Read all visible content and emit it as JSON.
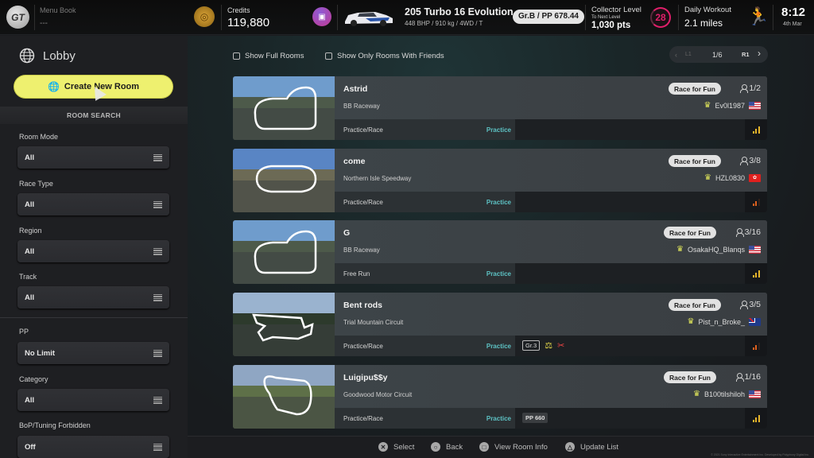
{
  "topbar": {
    "logo_icon": "gt-logo-icon",
    "menu_book_label": "Menu Book",
    "menu_book_value": "---",
    "credits_label": "Credits",
    "credits_value": "119,880",
    "car_name": "205 Turbo 16 Evolution...",
    "car_spec": "448 BHP / 910 kg / 4WD / T",
    "car_pp": "Gr.B / PP 678.44",
    "collector_label": "Collector Level",
    "collector_next_label": "To Next Level",
    "collector_points": "1,030 pts",
    "collector_level": "28",
    "workout_label": "Daily Workout",
    "workout_value": "2.1 miles",
    "time": "8:12",
    "date": "4th Mar"
  },
  "sidebar": {
    "title": "Lobby",
    "create_button": "Create New Room",
    "search_header": "ROOM SEARCH",
    "filters": [
      {
        "label": "Room Mode",
        "value": "All"
      },
      {
        "label": "Race Type",
        "value": "All"
      },
      {
        "label": "Region",
        "value": "All"
      },
      {
        "label": "Track",
        "value": "All"
      },
      {
        "label": "PP",
        "value": "No Limit"
      },
      {
        "label": "Category",
        "value": "All"
      },
      {
        "label": "BoP/Tuning Forbidden",
        "value": "Off"
      }
    ]
  },
  "main": {
    "show_full_rooms": "Show Full Rooms",
    "show_friends_rooms": "Show Only Rooms With Friends",
    "pager": {
      "prev_label": "L1",
      "page": "1/6",
      "next_label": "R1"
    },
    "rooms": [
      {
        "name": "Astrid",
        "track": "BB Raceway",
        "mode": "Practice/Race",
        "status": "Practice",
        "badge": "Race for Fun",
        "players": "1/2",
        "host": "Ev0l1987",
        "flag": "us",
        "signal": "good",
        "tags": []
      },
      {
        "name": "come",
        "track": "Northern Isle Speedway",
        "mode": "Practice/Race",
        "status": "Practice",
        "badge": "Race for Fun",
        "players": "3/8",
        "host": "HZL0830",
        "flag": "hk",
        "signal": "weak",
        "tags": []
      },
      {
        "name": "G",
        "track": "BB Raceway",
        "mode": "Free Run",
        "status": "Practice",
        "badge": "Race for Fun",
        "players": "3/16",
        "host": "OsakaHQ_Blanqs",
        "flag": "us",
        "signal": "good",
        "tags": []
      },
      {
        "name": "Bent rods",
        "track": "Trial Mountain Circuit",
        "mode": "Practice/Race",
        "status": "Practice",
        "badge": "Race for Fun",
        "players": "3/5",
        "host": "Pist_n_Broke_",
        "flag": "nz",
        "signal": "weak",
        "tags": [
          "Gr.3"
        ]
      },
      {
        "name": "Luigipu$$y",
        "track": "Goodwood Motor Circuit",
        "mode": "Practice/Race",
        "status": "Practice",
        "badge": "Race for Fun",
        "players": "1/16",
        "host": "B100tilshiloh",
        "flag": "us",
        "signal": "good",
        "tags": [
          "PP 660"
        ]
      }
    ]
  },
  "bottom": {
    "hints": [
      {
        "button": "cross",
        "label": "Select"
      },
      {
        "button": "circle",
        "label": "Back"
      },
      {
        "button": "square",
        "label": "View Room Info"
      },
      {
        "button": "triangle",
        "label": "Update List"
      }
    ],
    "copyright": "© 2021 Sony Interactive Entertainment Inc. Developed by Polyphony Digital Inc."
  },
  "colors": {
    "accent_yellow": "#eef06f",
    "status_teal": "#5dc2c4",
    "collector_pink": "#e01f6a",
    "signal_good": "#e3b32a",
    "signal_weak": "#e0601e"
  }
}
